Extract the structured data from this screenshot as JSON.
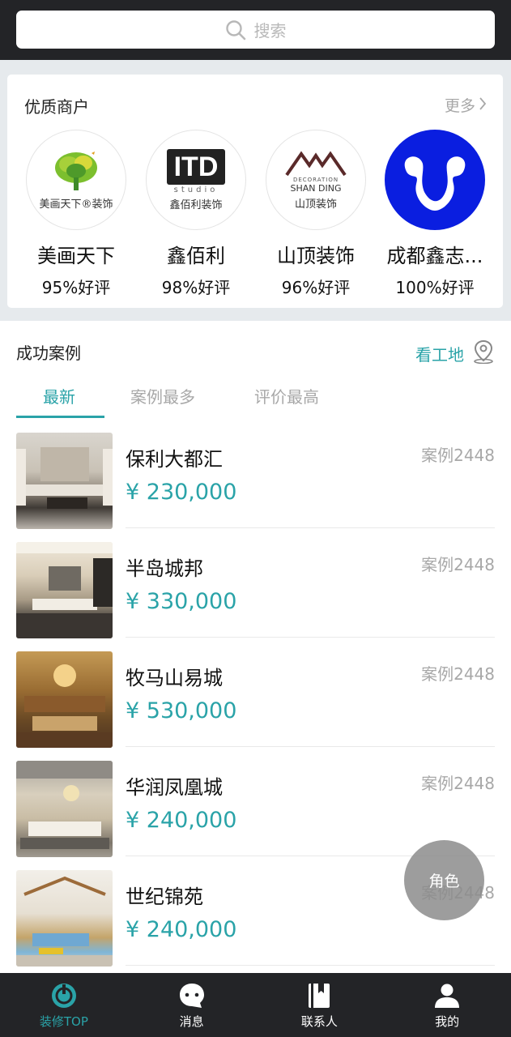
{
  "search": {
    "placeholder": "搜索",
    "icon": "search-icon"
  },
  "merchants": {
    "title": "优质商户",
    "more_label": "更多",
    "items": [
      {
        "name": "美画天下",
        "rating": "95%好评",
        "logo_text": "美画天下®装饰",
        "logo_color": "#5aa02c"
      },
      {
        "name": "鑫佰利",
        "rating": "98%好评",
        "logo_text": "鑫佰利装饰",
        "logo_mark": "ITD",
        "logo_sub": "studio"
      },
      {
        "name": "山顶装饰",
        "rating": "96%好评",
        "logo_text": "山顶装饰",
        "logo_sub": "SHAN DING",
        "logo_tag": "DECORATION"
      },
      {
        "name": "成都鑫志...",
        "rating": "100%好评",
        "logo_color": "#0a1ee0"
      }
    ]
  },
  "cases": {
    "title": "成功案例",
    "site_link": "看工地",
    "tabs": [
      {
        "label": "最新",
        "active": true
      },
      {
        "label": "案例最多",
        "active": false
      },
      {
        "label": "评价最高",
        "active": false
      }
    ],
    "items": [
      {
        "name": "保利大都汇",
        "price": "¥ 230,000",
        "count": "案例2448"
      },
      {
        "name": "半岛城邦",
        "price": "¥ 330,000",
        "count": "案例2448"
      },
      {
        "name": "牧马山易城",
        "price": "¥ 530,000",
        "count": "案例2448"
      },
      {
        "name": "华润凤凰城",
        "price": "¥ 240,000",
        "count": "案例2448"
      },
      {
        "name": "世纪锦苑",
        "price": "¥ 240,000",
        "count": "案例2448"
      }
    ]
  },
  "fab": {
    "label": "角色"
  },
  "bottom_nav": [
    {
      "label": "装修TOP",
      "icon": "home-ring-icon",
      "active": true
    },
    {
      "label": "消息",
      "icon": "chat-bubble-icon",
      "active": false
    },
    {
      "label": "联系人",
      "icon": "contacts-book-icon",
      "active": false
    },
    {
      "label": "我的",
      "icon": "user-icon",
      "active": false
    }
  ],
  "colors": {
    "accent": "#2aa3a8",
    "dark_bar": "#232427",
    "muted": "#a8a8a8"
  }
}
